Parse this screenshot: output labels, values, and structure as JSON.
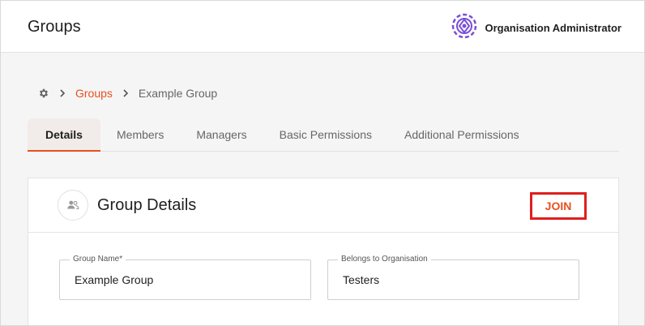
{
  "header": {
    "title": "Groups",
    "account_name": "Organisation Administrator",
    "brand_color": "#7b4fd6"
  },
  "breadcrumb": {
    "root_icon": "gear-icon",
    "items": [
      "Groups",
      "Example Group"
    ]
  },
  "tabs": [
    {
      "label": "Details",
      "active": true
    },
    {
      "label": "Members",
      "active": false
    },
    {
      "label": "Managers",
      "active": false
    },
    {
      "label": "Basic Permissions",
      "active": false
    },
    {
      "label": "Additional Permissions",
      "active": false
    }
  ],
  "card": {
    "icon": "people-icon",
    "title": "Group Details",
    "join_label": "JOIN",
    "fields": [
      {
        "label": "Group Name*",
        "value": "Example Group"
      },
      {
        "label": "Belongs to Organisation",
        "value": "Testers"
      }
    ]
  },
  "colors": {
    "accent": "#e8501f",
    "highlight": "#e01e1e"
  }
}
